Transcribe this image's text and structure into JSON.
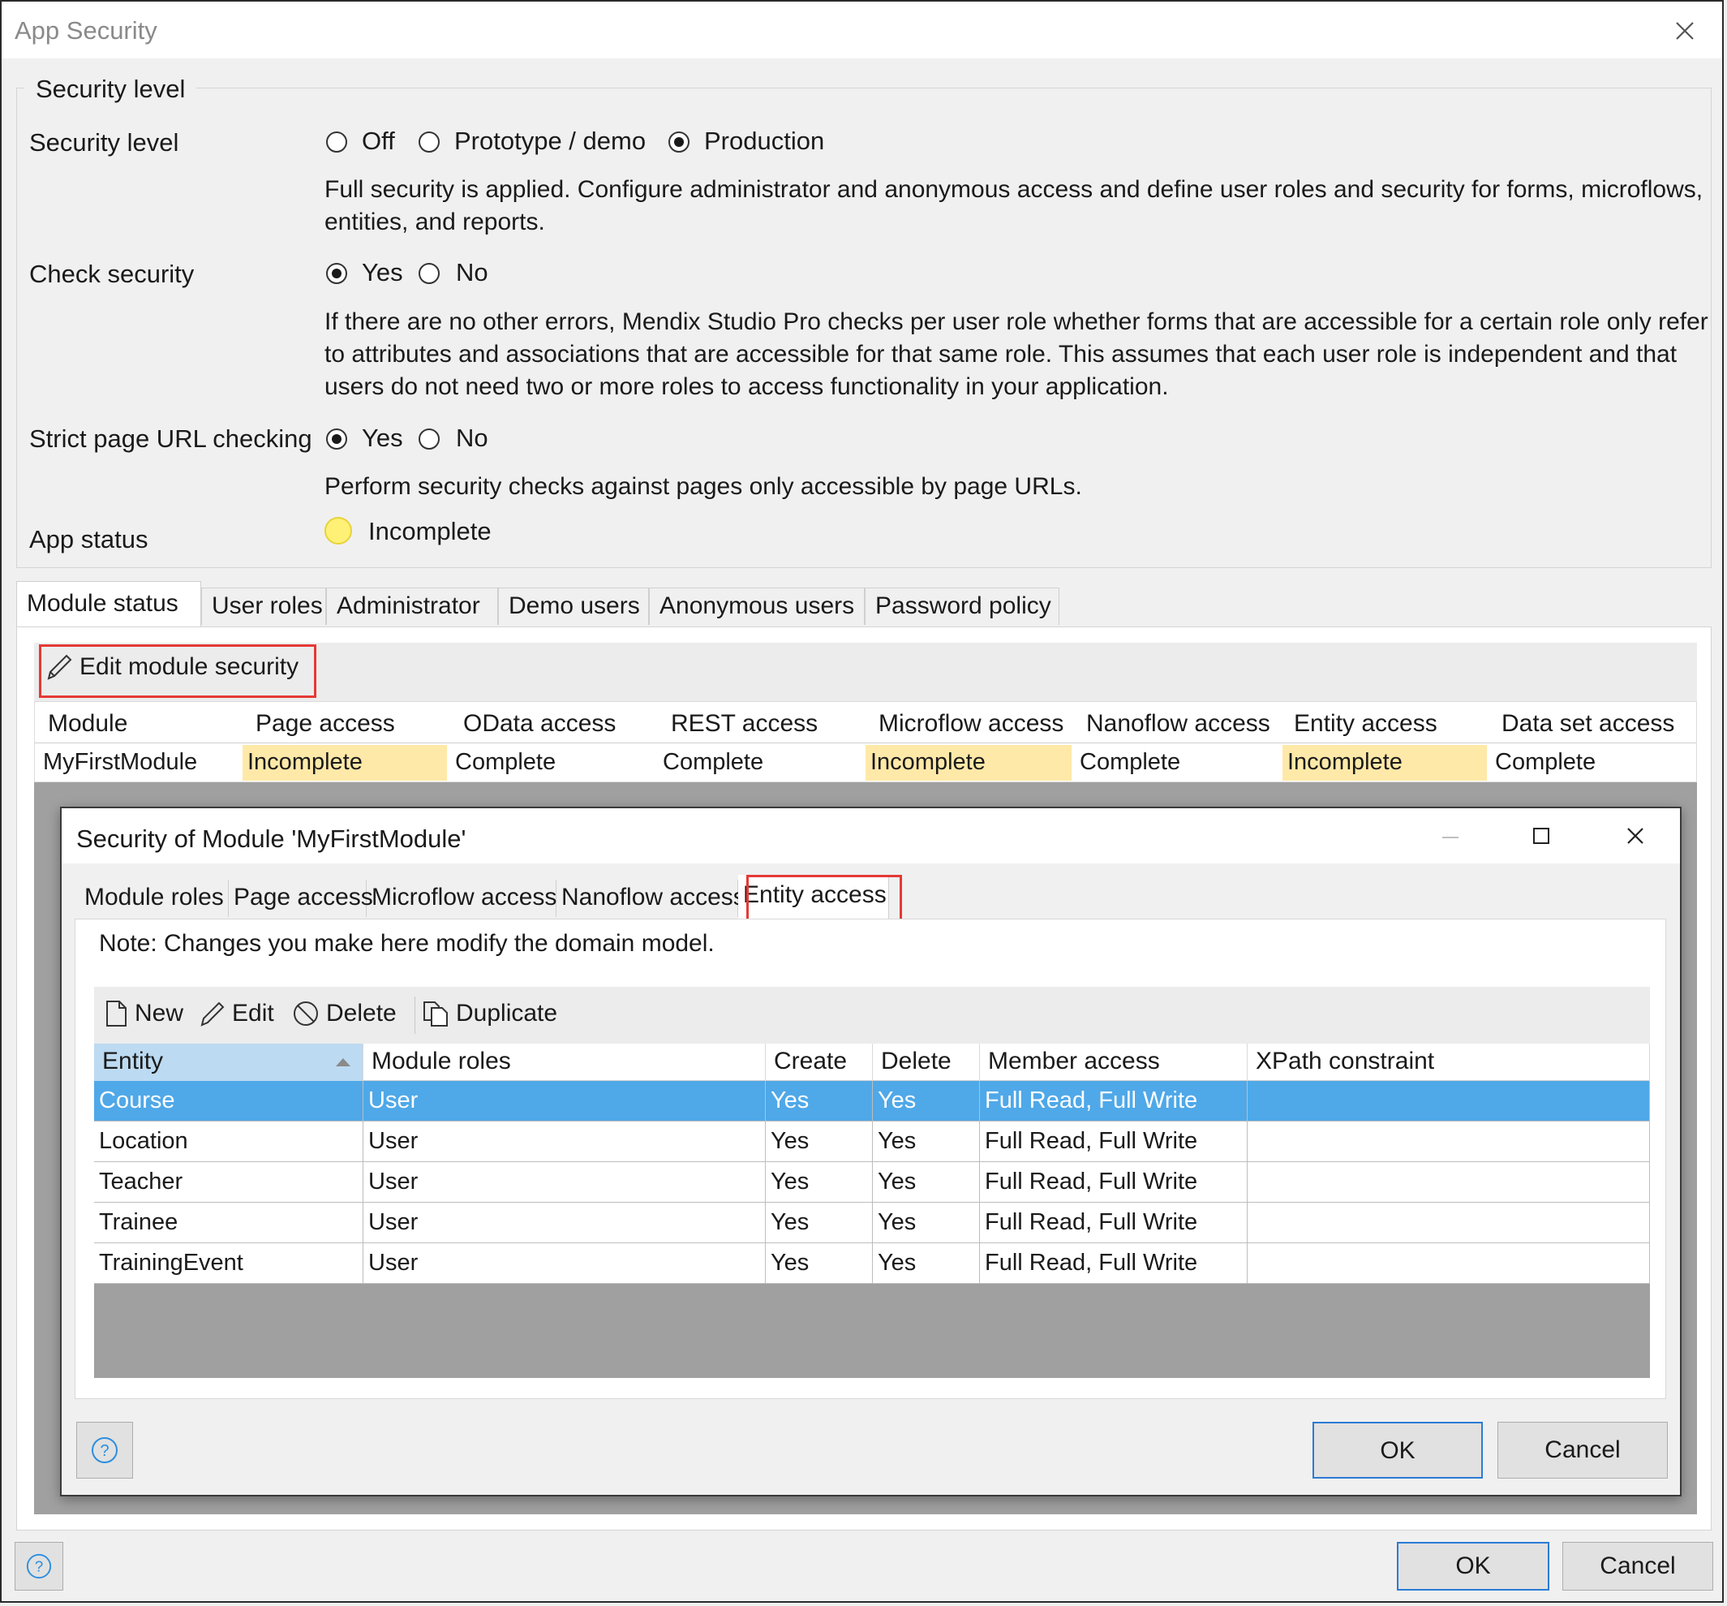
{
  "window": {
    "title": "App Security"
  },
  "security": {
    "group_title": "Security level",
    "level_label": "Security level",
    "level_options": [
      "Off",
      "Prototype / demo",
      "Production"
    ],
    "level_selected": "Production",
    "level_desc_line1": "Full security is applied. Configure administrator and anonymous access and define user roles and security for forms, microflows,",
    "level_desc_line2": "entities, and reports.",
    "check_label": "Check security",
    "check_yes": "Yes",
    "check_no": "No",
    "check_desc_line1": "If there are no other errors, Mendix Studio Pro checks per user role whether forms that are accessible for a certain role only refer",
    "check_desc_line2": "to attributes and associations that are accessible for that same role. This assumes that each user role is independent and that",
    "check_desc_line3": "users do not need two or more roles to access functionality in your application.",
    "strict_label": "Strict page URL checking",
    "strict_yes": "Yes",
    "strict_no": "No",
    "strict_desc": "Perform security checks against pages only accessible by page URLs.",
    "app_status_label": "App status",
    "app_status_value": "Incomplete",
    "app_status_color": "#fff176"
  },
  "tabs": [
    "Module status",
    "User roles",
    "Administrator",
    "Demo users",
    "Anonymous users",
    "Password policy"
  ],
  "module_status": {
    "edit_button": "Edit module security",
    "columns": [
      "Module",
      "Page access",
      "OData access",
      "REST access",
      "Microflow access",
      "Nanoflow access",
      "Entity access",
      "Data set access"
    ],
    "row": [
      "MyFirstModule",
      "Incomplete",
      "Complete",
      "Complete",
      "Incomplete",
      "Complete",
      "Incomplete",
      "Complete"
    ]
  },
  "module_dialog": {
    "title": "Security of Module 'MyFirstModule'",
    "tabs": [
      "Module roles",
      "Page access",
      "Microflow access",
      "Nanoflow access",
      "Entity access"
    ],
    "active_tab": "Entity access",
    "note": "Note: Changes you make here modify the domain model.",
    "toolbar": {
      "new": "New",
      "edit": "Edit",
      "delete": "Delete",
      "duplicate": "Duplicate"
    },
    "columns": [
      "Entity",
      "Module roles",
      "Create",
      "Delete",
      "Member access",
      "XPath constraint"
    ],
    "rows": [
      [
        "Course",
        "User",
        "Yes",
        "Yes",
        "Full Read, Full Write",
        ""
      ],
      [
        "Location",
        "User",
        "Yes",
        "Yes",
        "Full Read, Full Write",
        ""
      ],
      [
        "Teacher",
        "User",
        "Yes",
        "Yes",
        "Full Read, Full Write",
        ""
      ],
      [
        "Trainee",
        "User",
        "Yes",
        "Yes",
        "Full Read, Full Write",
        ""
      ],
      [
        "TrainingEvent",
        "User",
        "Yes",
        "Yes",
        "Full Read, Full Write",
        ""
      ]
    ],
    "selected_row": "Course",
    "ok": "OK",
    "cancel": "Cancel"
  },
  "footer": {
    "ok": "OK",
    "cancel": "Cancel"
  },
  "colors": {
    "highlight": "#e53935",
    "selection": "#4fa8e8",
    "incomplete": "#ffe9a8"
  }
}
